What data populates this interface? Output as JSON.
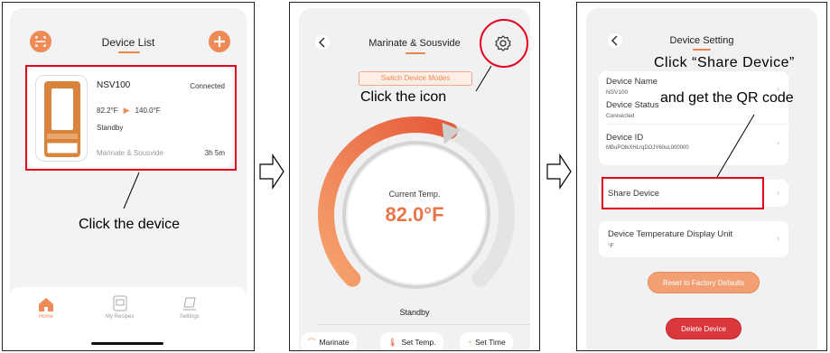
{
  "panel1": {
    "title": "Device List",
    "device": {
      "name": "NSV100",
      "status": "Connected",
      "current_temp": "82.2°F",
      "target_temp": "140.0°F",
      "state": "Standby",
      "mode": "Marinate & Sousvide",
      "time": "3h 5m"
    },
    "nav": {
      "home": "Home",
      "recipes": "My Recipes",
      "settings": "Settings"
    },
    "annotation": "Click the device"
  },
  "panel2": {
    "title": "Marinate & Sousvide",
    "switch_modes": "Switch Device Modes",
    "annotation": "Click the icon",
    "temp_label": "Current Temp.",
    "temp_value": "82.0°F",
    "state": "Standby",
    "gauge_fraction": 0.58,
    "buttons": {
      "marinate": "Marinate",
      "set_temp": "Set Temp.",
      "set_time": "Set Time"
    }
  },
  "panel3": {
    "title": "Device Setting",
    "annotation_line1": "Click “Share Device”",
    "annotation_line2": "and get the QR code",
    "rows": {
      "device_name_label": "Device Name",
      "device_name_value": "NSV100",
      "device_status_label": "Device Status",
      "device_status_value": "Connected",
      "device_id_label": "Device ID",
      "device_id_value": "MBuPOlkXHLrqDOJY60uL000000",
      "share_device": "Share Device",
      "temp_unit_label": "Device Temperature Display Unit",
      "temp_unit_value": "°F"
    },
    "reset_button": "Reset to Factory Defaults",
    "delete_button": "Delete Device"
  },
  "colors": {
    "accent": "#ee8a55",
    "red_annotation": "#e2001a",
    "delete": "#d9373c",
    "temp_text": "#e8764a"
  },
  "icons": [
    "scan-icon",
    "plus-icon",
    "back-icon",
    "gear-icon",
    "home-icon",
    "recipes-icon",
    "settings-icon",
    "chevron-right-icon",
    "arrow-right-icon"
  ]
}
